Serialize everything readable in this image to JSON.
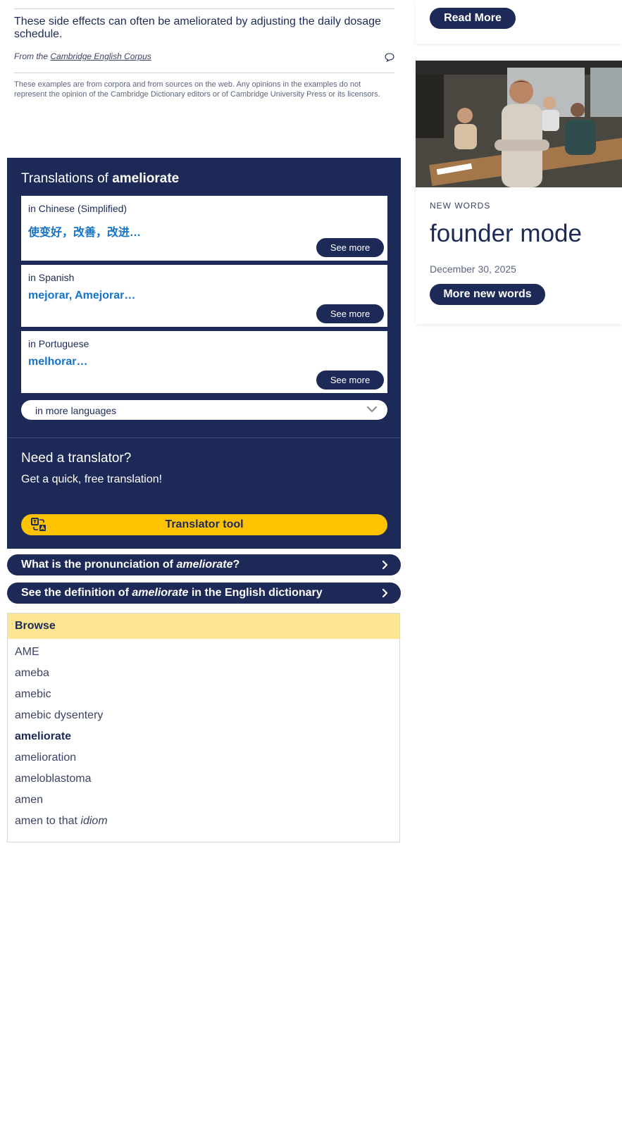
{
  "example": {
    "text": "These side effects can often be ameliorated by adjusting the daily dosage schedule.",
    "source_prefix": "From the",
    "source_link": "Cambridge English Corpus",
    "disclaimer": "These examples are from corpora and from sources on the web. Any opinions in the examples do not represent the opinion of the Cambridge Dictionary editors or of Cambridge University Press or its licensors."
  },
  "translations": {
    "title_prefix": "Translations of",
    "word": "ameliorate",
    "items": [
      {
        "language": "in Chinese (Simplified)",
        "value": "使变好，改善，改进…",
        "button": "See more"
      },
      {
        "language": "in Spanish",
        "value": "mejorar, Amejorar…",
        "button": "See more"
      },
      {
        "language": "in Portuguese",
        "value": "melhorar…",
        "button": "See more"
      }
    ],
    "more_languages": "in more languages",
    "need_title": "Need a translator?",
    "need_sub": "Get a quick, free translation!",
    "translator_button": "Translator tool"
  },
  "links": {
    "pronunciation": {
      "prefix": "What is the pronunciation of ",
      "word": "ameliorate",
      "suffix": "?"
    },
    "definition": {
      "prefix": "See the definition of ",
      "word": "ameliorate",
      "suffix": " in the English dictionary"
    }
  },
  "browse": {
    "title": "Browse",
    "items": [
      {
        "text": "AME"
      },
      {
        "text": "ameba"
      },
      {
        "text": "amebic"
      },
      {
        "text": "amebic dysentery"
      },
      {
        "text": "ameliorate",
        "current": true
      },
      {
        "text": "amelioration"
      },
      {
        "text": "ameloblastoma"
      },
      {
        "text": "amen"
      },
      {
        "text": "amen to that",
        "label": "idiom"
      }
    ]
  },
  "sidebar": {
    "read_more": "Read More",
    "new_words": {
      "kicker": "NEW WORDS",
      "headline": "founder mode",
      "date": "December 30, 2025",
      "button": "More new words"
    }
  },
  "colors": {
    "navy": "#1d2957",
    "link_blue": "#1673c7",
    "yellow": "#fec300",
    "browse_header": "#fee592"
  }
}
